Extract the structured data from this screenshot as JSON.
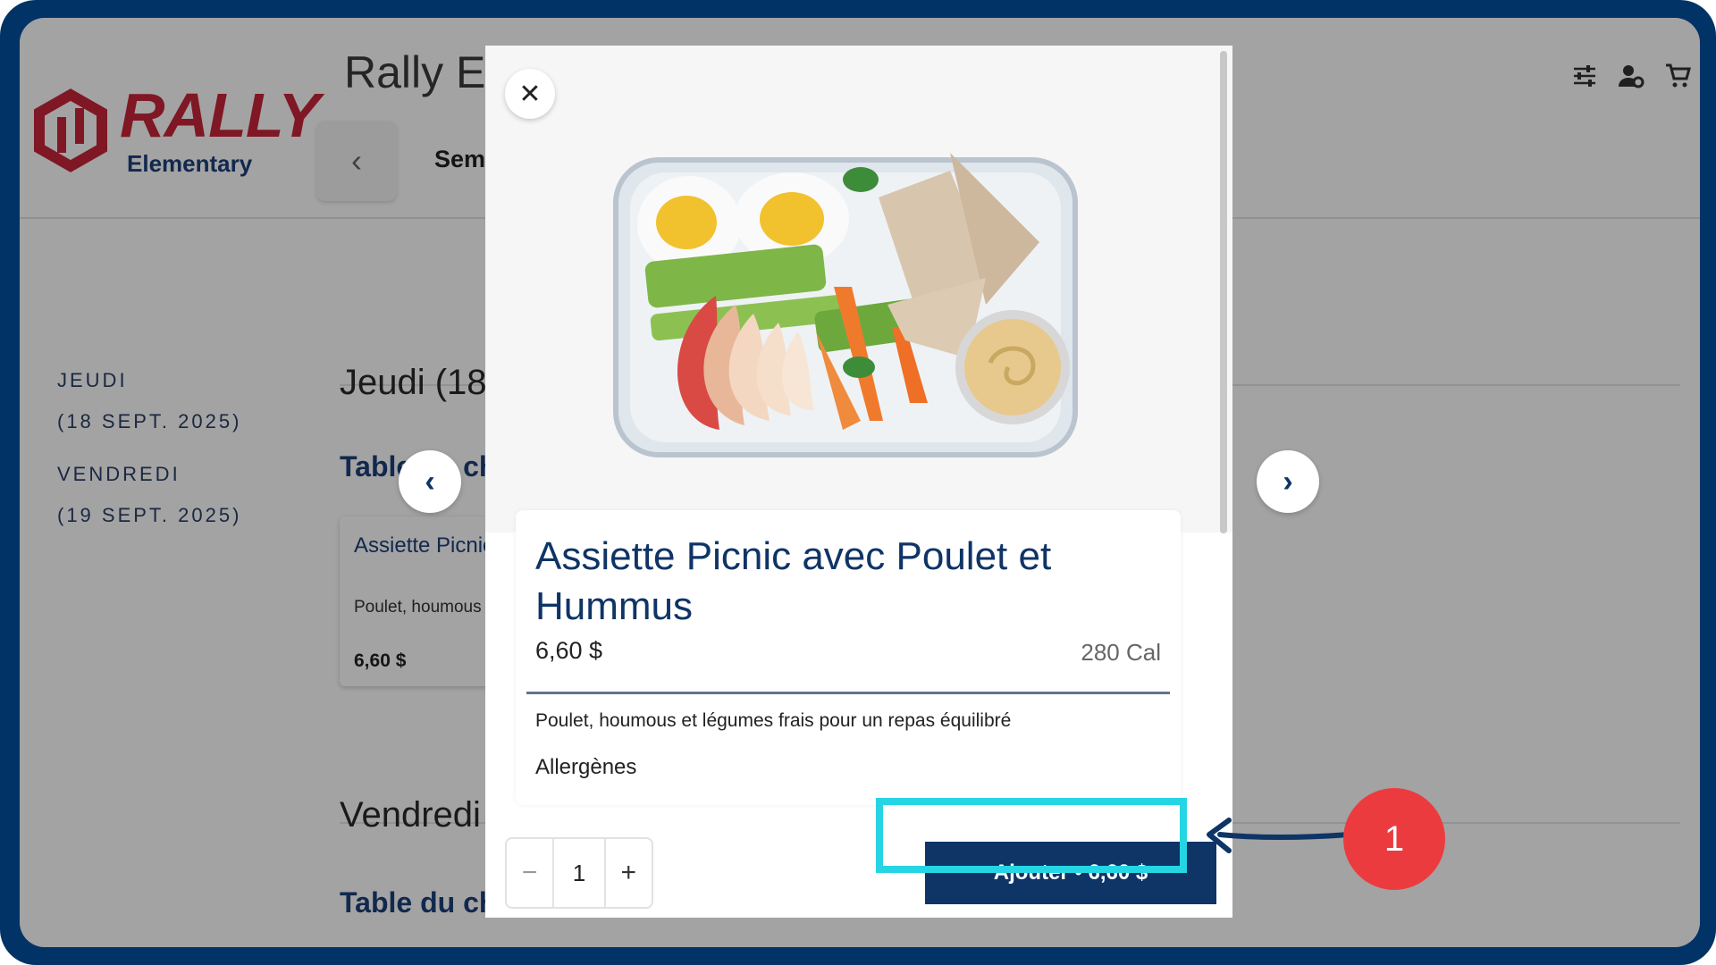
{
  "header": {
    "logo_text": "RALLY",
    "logo_subtext": "Elementary",
    "school_title": "Rally El",
    "week_label": "Sem",
    "icons": [
      "filter-icon",
      "account-settings-icon",
      "cart-icon"
    ]
  },
  "sidebar": {
    "days": [
      {
        "day": "JEUDI",
        "date": "(18 SEPT. 2025)"
      },
      {
        "day": "VENDREDI",
        "date": "(19 SEPT. 2025)"
      }
    ]
  },
  "main": {
    "days": [
      {
        "heading": "Jeudi (18",
        "table_heading": "Table du ch"
      },
      {
        "heading": "Vendredi",
        "table_heading": "Table du ch"
      }
    ],
    "card": {
      "title": "Assiette Picnic avec Poulet",
      "desc": "Poulet, houmous légumes frais po",
      "price": "6,60 $"
    }
  },
  "modal": {
    "item_title": "Assiette Picnic avec Poulet et Hummus",
    "price": "6,60 $",
    "calories": "280 Cal",
    "description": "Poulet, houmous et légumes frais pour un repas équilibré",
    "allergens_label": "Allergènes",
    "quantity": "1",
    "minus_label": "−",
    "plus_label": "+",
    "add_button_label": "Ajouter • 6,60 $",
    "close_label": "✕"
  },
  "annotation": {
    "step_number": "1",
    "highlight_color": "#25d5e4",
    "badge_color": "#ec3b3e"
  }
}
